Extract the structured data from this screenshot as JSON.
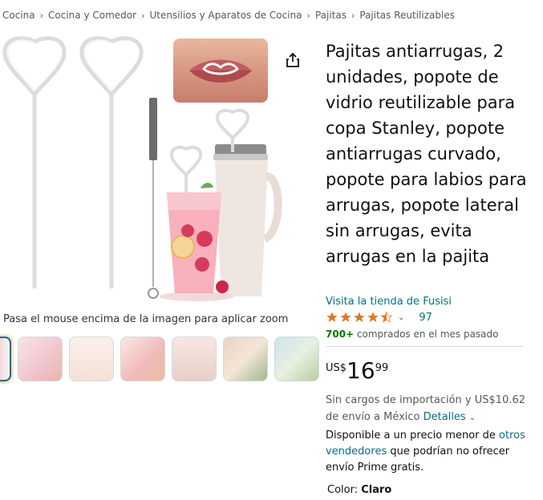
{
  "breadcrumb": [
    "Cocina",
    "Cocina y Comedor",
    "Utensilios y Aparatos de Cocina",
    "Pajitas",
    "Pajitas Reutilizables"
  ],
  "breadcrumb_separator": "›",
  "product": {
    "title": "Pajitas antiarrugas, 2 unidades, popote de vidrio reutilizable para copa Stanley, popote antiarrugas curvado, popote para labios para arrugas, popote lateral sin arrugas, evita arrugas en la pajita",
    "store_link": "Visita la tienda de Fusisi",
    "rating_stars": 4.5,
    "rating_count": "97",
    "bought_strong": "700+",
    "bought_rest": " comprados en el mes pasado",
    "price": {
      "currency": "US$",
      "whole": "16",
      "fraction": "99"
    },
    "shipping": {
      "text": "Sin cargos de importación y US$10.62 de envío a México ",
      "details_link": "Detalles"
    },
    "other_sellers": {
      "prefix": "Disponible a un precio menor de ",
      "link": "otros vendedores",
      "suffix": " que podrían no ofrecer envío Prime gratis."
    },
    "color": {
      "label": "Color: ",
      "value": "Claro"
    }
  },
  "image": {
    "zoom_hint": "Pasa el mouse encima de la imagen para aplicar zoom"
  },
  "thumbnails": [
    "thumb-1",
    "thumb-2",
    "thumb-3",
    "thumb-4",
    "thumb-5",
    "thumb-6",
    "thumb-7"
  ],
  "colors": {
    "link": "#007185",
    "bought": "#007600",
    "star": "#de7921",
    "text": "#0f1111",
    "muted": "#565959"
  },
  "icons": {
    "share": "share-icon",
    "star": "star-icon",
    "chevron": "chevron-down-icon"
  }
}
